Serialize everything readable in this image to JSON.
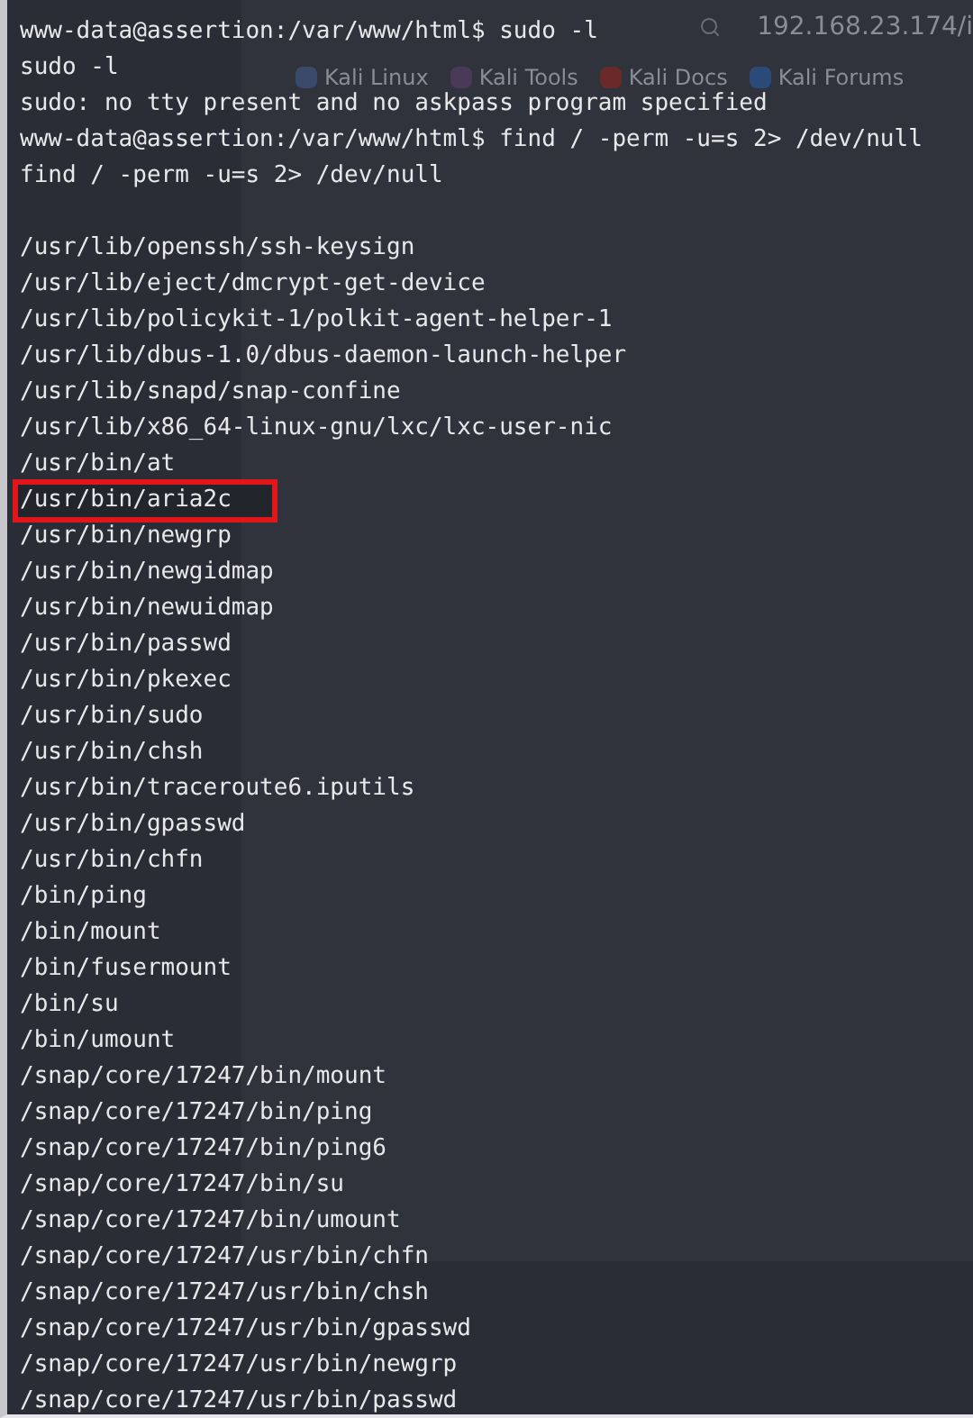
{
  "browser_behind": {
    "address": "192.168.23.174/i",
    "bookmarks": [
      "Kali Linux",
      "Kali Tools",
      "Kali Docs",
      "Kali Forums"
    ]
  },
  "terminal": {
    "lines": [
      {
        "kind": "text",
        "text": "www-data@assertion:/var/www/html$ sudo -l",
        "highlighted": false
      },
      {
        "kind": "text",
        "text": "sudo -l",
        "highlighted": false
      },
      {
        "kind": "text",
        "text": "sudo: no tty present and no askpass program specified",
        "highlighted": false
      },
      {
        "kind": "text",
        "text": "www-data@assertion:/var/www/html$ find / -perm -u=s 2> /dev/null",
        "highlighted": false
      },
      {
        "kind": "text",
        "text": "find / -perm -u=s 2> /dev/null",
        "highlighted": false
      },
      {
        "kind": "blank"
      },
      {
        "kind": "text",
        "text": "/usr/lib/openssh/ssh-keysign",
        "highlighted": false
      },
      {
        "kind": "text",
        "text": "/usr/lib/eject/dmcrypt-get-device",
        "highlighted": false
      },
      {
        "kind": "text",
        "text": "/usr/lib/policykit-1/polkit-agent-helper-1",
        "highlighted": false
      },
      {
        "kind": "text",
        "text": "/usr/lib/dbus-1.0/dbus-daemon-launch-helper",
        "highlighted": false
      },
      {
        "kind": "text",
        "text": "/usr/lib/snapd/snap-confine",
        "highlighted": false
      },
      {
        "kind": "text",
        "text": "/usr/lib/x86_64-linux-gnu/lxc/lxc-user-nic",
        "highlighted": false
      },
      {
        "kind": "text",
        "text": "/usr/bin/at",
        "highlighted": false
      },
      {
        "kind": "text",
        "text": "/usr/bin/aria2c",
        "highlighted": true
      },
      {
        "kind": "text",
        "text": "/usr/bin/newgrp",
        "highlighted": false
      },
      {
        "kind": "text",
        "text": "/usr/bin/newgidmap",
        "highlighted": false
      },
      {
        "kind": "text",
        "text": "/usr/bin/newuidmap",
        "highlighted": false
      },
      {
        "kind": "text",
        "text": "/usr/bin/passwd",
        "highlighted": false
      },
      {
        "kind": "text",
        "text": "/usr/bin/pkexec",
        "highlighted": false
      },
      {
        "kind": "text",
        "text": "/usr/bin/sudo",
        "highlighted": false
      },
      {
        "kind": "text",
        "text": "/usr/bin/chsh",
        "highlighted": false
      },
      {
        "kind": "text",
        "text": "/usr/bin/traceroute6.iputils",
        "highlighted": false
      },
      {
        "kind": "text",
        "text": "/usr/bin/gpasswd",
        "highlighted": false
      },
      {
        "kind": "text",
        "text": "/usr/bin/chfn",
        "highlighted": false
      },
      {
        "kind": "text",
        "text": "/bin/ping",
        "highlighted": false
      },
      {
        "kind": "text",
        "text": "/bin/mount",
        "highlighted": false
      },
      {
        "kind": "text",
        "text": "/bin/fusermount",
        "highlighted": false
      },
      {
        "kind": "text",
        "text": "/bin/su",
        "highlighted": false
      },
      {
        "kind": "text",
        "text": "/bin/umount",
        "highlighted": false
      },
      {
        "kind": "text",
        "text": "/snap/core/17247/bin/mount",
        "highlighted": false
      },
      {
        "kind": "text",
        "text": "/snap/core/17247/bin/ping",
        "highlighted": false
      },
      {
        "kind": "text",
        "text": "/snap/core/17247/bin/ping6",
        "highlighted": false
      },
      {
        "kind": "text",
        "text": "/snap/core/17247/bin/su",
        "highlighted": false
      },
      {
        "kind": "text",
        "text": "/snap/core/17247/bin/umount",
        "highlighted": false
      },
      {
        "kind": "text",
        "text": "/snap/core/17247/usr/bin/chfn",
        "highlighted": false
      },
      {
        "kind": "text",
        "text": "/snap/core/17247/usr/bin/chsh",
        "highlighted": false
      },
      {
        "kind": "text",
        "text": "/snap/core/17247/usr/bin/gpasswd",
        "highlighted": false
      },
      {
        "kind": "text",
        "text": "/snap/core/17247/usr/bin/newgrp",
        "highlighted": false
      },
      {
        "kind": "text",
        "text": "/snap/core/17247/usr/bin/passwd",
        "highlighted": false
      }
    ]
  }
}
